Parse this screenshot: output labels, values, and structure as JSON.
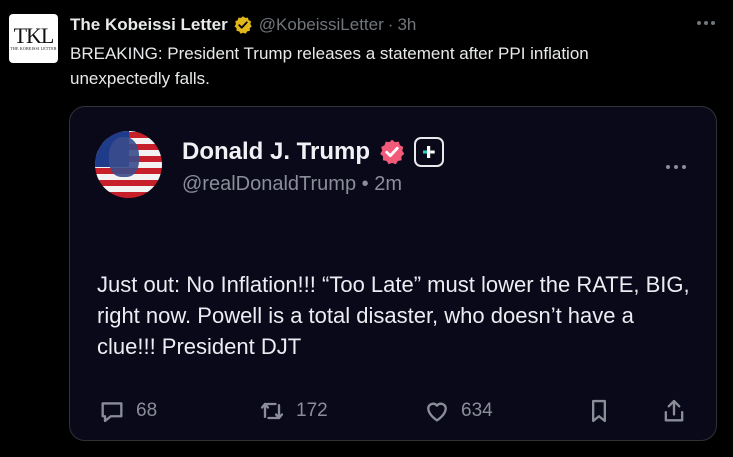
{
  "post": {
    "author_name": "The Kobeissi Letter",
    "author_handle": "@KobeissiLetter",
    "separator": "·",
    "time": "3h",
    "avatar_text": "TKL",
    "avatar_subtext": "THE KOBEISSI LETTER",
    "text": "BREAKING: President Trump releases a statement after PPI inflation unexpectedly falls.",
    "verified_badge_color": "#e2b719"
  },
  "quoted": {
    "author_name": "Donald J. Trump",
    "author_handle": "@realDonaldTrump",
    "separator": "•",
    "time": "2m",
    "badge_color": "#f25a7a",
    "text": "Just out: No Inflation!!! “Too Late” must lower the RATE, BIG, right now. Powell is a total disaster, who doesn’t have a clue!!! President DJT",
    "actions": {
      "replies": "68",
      "reposts": "172",
      "likes": "634"
    }
  },
  "icons": [
    "gold-verified-icon",
    "more-icon",
    "pink-verified-icon",
    "follow-plus-icon",
    "reply-icon",
    "repost-icon",
    "like-icon",
    "bookmark-icon",
    "share-icon"
  ]
}
